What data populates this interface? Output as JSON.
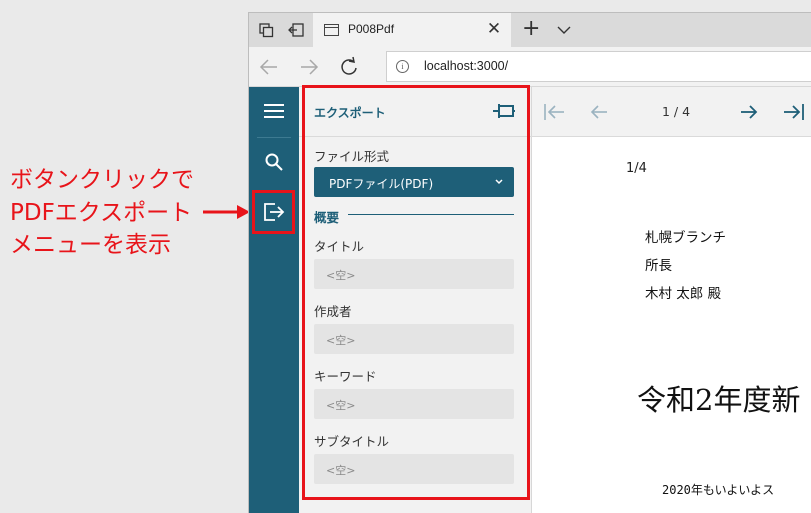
{
  "annotation": {
    "lines": [
      "ボタンクリックで",
      "PDFエクスポート",
      "メニューを表示"
    ],
    "color": "#e8141a"
  },
  "browser": {
    "tab_title": "P008Pdf",
    "url": "localhost:3000/"
  },
  "sidebar": {
    "color": "#1e5f78",
    "items": [
      {
        "icon": "hamburger-menu-icon"
      },
      {
        "icon": "search-icon"
      },
      {
        "icon": "export-icon"
      }
    ]
  },
  "export_panel": {
    "title": "エクスポート",
    "file_format_label": "ファイル形式",
    "file_format_value": "PDFファイル(PDF)",
    "section_label": "概要",
    "fields": [
      {
        "label": "タイトル",
        "placeholder": "<空>"
      },
      {
        "label": "作成者",
        "placeholder": "<空>"
      },
      {
        "label": "キーワード",
        "placeholder": "<空>"
      },
      {
        "label": "サブタイトル",
        "placeholder": "<空>"
      }
    ]
  },
  "viewer": {
    "page_indicator": "1 / 4",
    "document": {
      "page_number": "1/4",
      "lines": [
        "札幌ブランチ",
        "所長",
        "木村 太郎 殿"
      ],
      "title": "令和2年度新",
      "body": [
        "2020年もいよいよス",
        "　　　　　　　　　　"
      ]
    }
  }
}
